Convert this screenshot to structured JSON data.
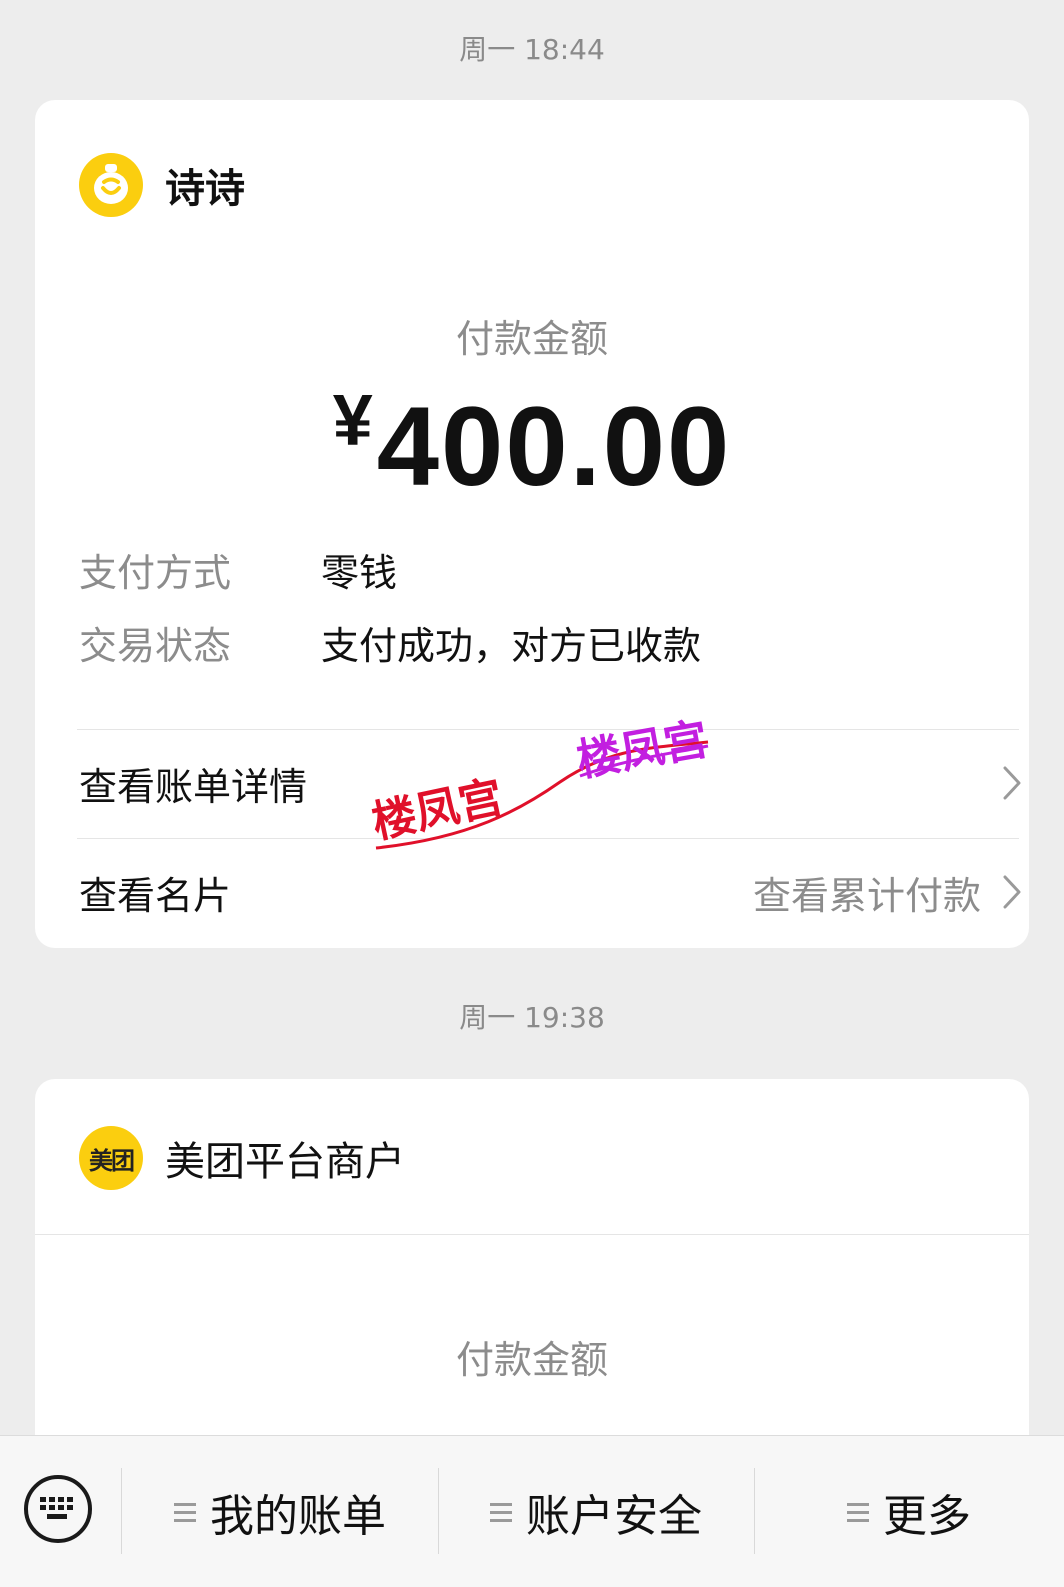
{
  "messages": [
    {
      "timestamp": "周一 18:44",
      "payee": "诗诗",
      "amount_label": "付款金额",
      "currency": "¥",
      "amount": "400.00",
      "details": [
        {
          "key": "支付方式",
          "value": "零钱"
        },
        {
          "key": "交易状态",
          "value": "支付成功，对方已收款"
        }
      ],
      "links": {
        "bill_detail": "查看账单详情",
        "business_card": "查看名片",
        "cumulative": "查看累计付款"
      }
    },
    {
      "timestamp": "周一 19:38",
      "payee": "美团平台商户",
      "avatar_text": "美团",
      "amount_label": "付款金额"
    }
  ],
  "watermark": {
    "text_1": "楼凤宫",
    "text_2": "楼凤宫",
    "color_1": "#e0102a",
    "color_2": "#c21fe0"
  },
  "bottom_bar": {
    "tabs": [
      "我的账单",
      "账户安全",
      "更多"
    ]
  },
  "colors": {
    "background": "#ededed",
    "card": "#ffffff",
    "avatar_yellow": "#fbce0f",
    "muted_text": "#8c8c8c"
  },
  "icons": [
    "alarm-clock-icon",
    "chevron-right-icon",
    "keyboard-icon",
    "menu-icon"
  ]
}
